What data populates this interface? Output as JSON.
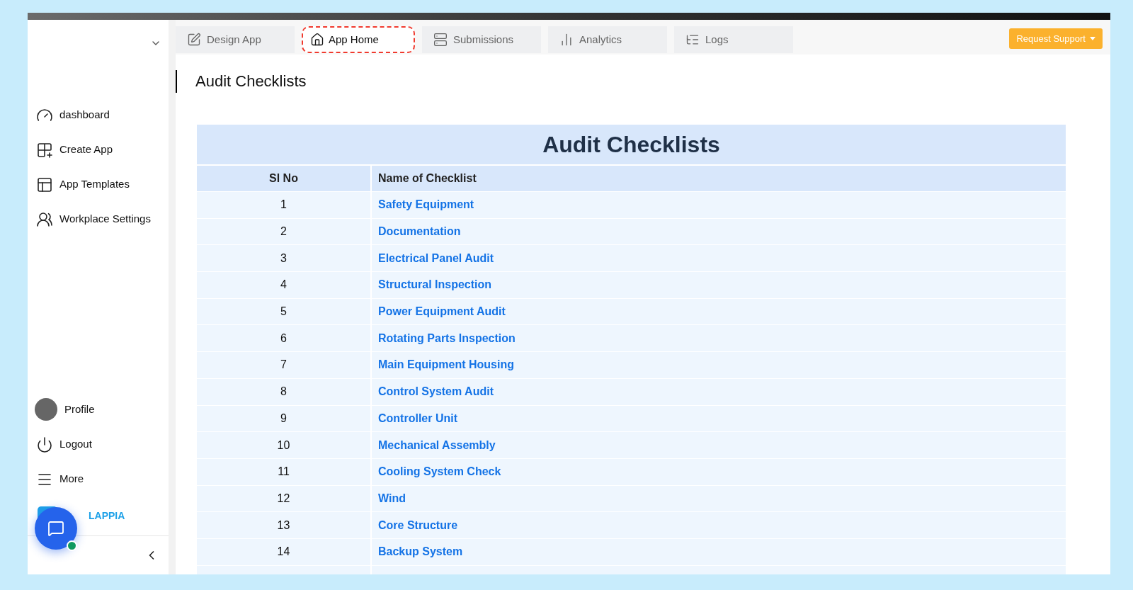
{
  "sidebar": {
    "items": [
      "dashboard",
      "Create App",
      "App Templates",
      "Workplace Settings"
    ],
    "profile": "Profile",
    "bottom_items": [
      "Logout",
      "More"
    ],
    "logo": "LAPPIA"
  },
  "tabs": [
    {
      "label": "Design App",
      "selected": false
    },
    {
      "label": "App Home",
      "selected": true
    },
    {
      "label": "Submissions",
      "selected": false
    },
    {
      "label": "Analytics",
      "selected": false
    },
    {
      "label": "Logs",
      "selected": false
    }
  ],
  "request_support": "Request Support",
  "page_title": "Audit Checklists",
  "table": {
    "title": "Audit Checklists",
    "columns": [
      "Sl No",
      "Name of Checklist"
    ],
    "rows": [
      {
        "sl": "1",
        "name": "Safety Equipment"
      },
      {
        "sl": "2",
        "name": "Documentation"
      },
      {
        "sl": "3",
        "name": "Electrical Panel Audit"
      },
      {
        "sl": "4",
        "name": "Structural Inspection"
      },
      {
        "sl": "5",
        "name": "Power Equipment Audit"
      },
      {
        "sl": "6",
        "name": "Rotating Parts Inspection"
      },
      {
        "sl": "7",
        "name": "Main Equipment Housing"
      },
      {
        "sl": "8",
        "name": "Control System Audit"
      },
      {
        "sl": "9",
        "name": "Controller Unit"
      },
      {
        "sl": "10",
        "name": "Mechanical Assembly"
      },
      {
        "sl": "11",
        "name": "Cooling System Check"
      },
      {
        "sl": "12",
        "name": "Wind"
      },
      {
        "sl": "13",
        "name": "Core Structure"
      },
      {
        "sl": "14",
        "name": "Backup System"
      }
    ]
  }
}
